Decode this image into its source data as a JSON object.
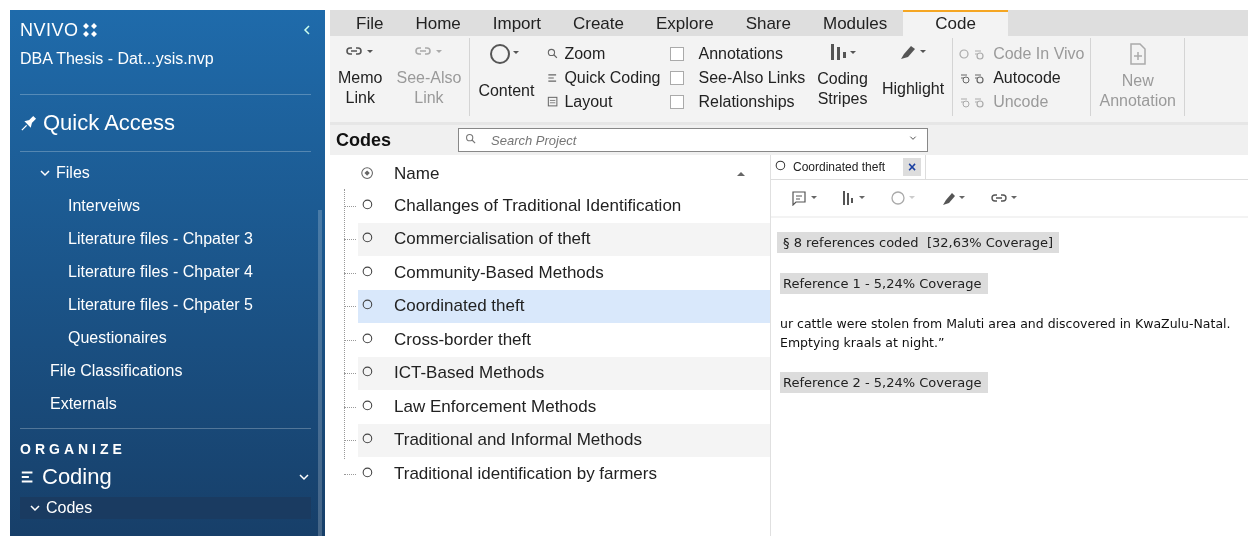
{
  "sidebar": {
    "logo": "NVIVO",
    "project": "DBA Thesis - Dat...ysis.nvp",
    "quick_access": "Quick Access",
    "nav": [
      {
        "label": "Files",
        "expanded": true,
        "children": [
          {
            "label": "Interveiws"
          },
          {
            "label": "Literature files - Chpater 3"
          },
          {
            "label": "Literature files - Chpater 4"
          },
          {
            "label": "Literature files - Chpater 5"
          },
          {
            "label": "Questionaires"
          }
        ]
      },
      {
        "label": "File Classifications"
      },
      {
        "label": "Externals"
      }
    ],
    "section": "ORGANIZE",
    "group": {
      "label": "Coding",
      "expanded": true,
      "children": [
        {
          "label": "Codes",
          "expanded": true,
          "selected": true
        }
      ]
    }
  },
  "ribbon": {
    "tabs": [
      {
        "label": "File",
        "selected": false
      },
      {
        "label": "Home",
        "selected": false
      },
      {
        "label": "Import",
        "selected": false
      },
      {
        "label": "Create",
        "selected": false
      },
      {
        "label": "Explore",
        "selected": false
      },
      {
        "label": "Share",
        "selected": false
      },
      {
        "label": "Modules",
        "selected": false
      },
      {
        "label": "Code",
        "selected": true
      }
    ],
    "groups": [
      {
        "columns": [
          {
            "kind": "large",
            "label": "Memo\nLink",
            "disabled": false
          },
          {
            "kind": "large",
            "label": "See-Also\nLink",
            "disabled": true
          }
        ]
      },
      {
        "columns": [
          {
            "kind": "large",
            "label": "Content",
            "disabled": false
          },
          {
            "kind": "stack",
            "items": [
              {
                "kind": "small",
                "label": "Zoom",
                "disabled": false
              },
              {
                "kind": "small",
                "label": "Quick Coding",
                "disabled": false
              },
              {
                "kind": "small",
                "label": "Layout",
                "disabled": false
              }
            ]
          },
          {
            "kind": "stack",
            "items": [
              {
                "kind": "checkbox",
                "label": "Annotations",
                "checked": false
              },
              {
                "kind": "checkbox",
                "label": "See-Also Links",
                "checked": false
              },
              {
                "kind": "checkbox",
                "label": "Relationships",
                "checked": false
              }
            ]
          },
          {
            "kind": "large",
            "label": "Coding\nStripes",
            "disabled": false
          },
          {
            "kind": "large",
            "label": "Highlight",
            "disabled": false
          }
        ]
      },
      {
        "columns": [
          {
            "kind": "stack",
            "items": [
              {
                "kind": "small",
                "label": "Code In Vivo",
                "disabled": true
              },
              {
                "kind": "small",
                "label": "Autocode",
                "disabled": false
              },
              {
                "kind": "small",
                "label": "Uncode",
                "disabled": true
              }
            ]
          }
        ]
      },
      {
        "columns": [
          {
            "kind": "large",
            "label": "New\nAnnotation",
            "disabled": true
          }
        ]
      }
    ]
  },
  "codes": {
    "title": "Codes",
    "search": {
      "placeholder": "Search Project"
    },
    "column": "Name",
    "items": [
      {
        "name": "Challanges of Traditional Identification",
        "selected": false
      },
      {
        "name": "Commercialisation of theft",
        "selected": false
      },
      {
        "name": "Community-Based Methods",
        "selected": false
      },
      {
        "name": "Coordinated theft",
        "selected": true
      },
      {
        "name": "Cross-border theft",
        "selected": false
      },
      {
        "name": "ICT-Based Methods",
        "selected": false
      },
      {
        "name": "Law Enforcement Methods",
        "selected": false
      },
      {
        "name": "Traditional and Informal Methods",
        "selected": false
      },
      {
        "name": "Traditional identification by farmers",
        "selected": false
      }
    ]
  },
  "detail": {
    "tab": {
      "label": "Coordinated theft",
      "close": "×"
    },
    "summary": "§ 8 references coded  [32,63% Coverage]",
    "blocks": [
      {
        "kind": "reference",
        "text": "Reference 1 - 5,24% Coverage"
      },
      {
        "kind": "text",
        "text": "ur cattle were stolen from Maluti area and discovered in KwaZulu-Natal. Emptying kraals at night.”"
      },
      {
        "kind": "reference",
        "text": "Reference 2 - 5,24% Coverage"
      }
    ]
  }
}
